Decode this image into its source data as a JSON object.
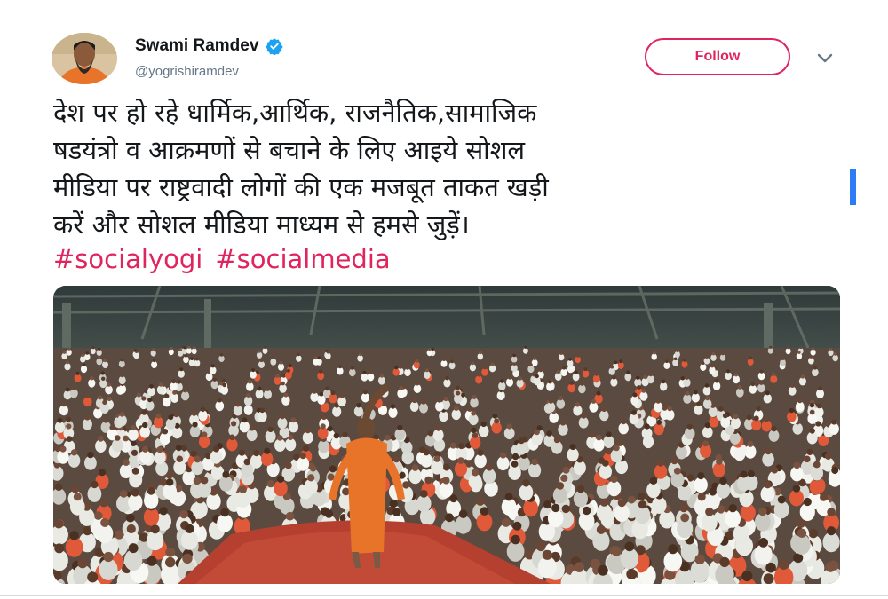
{
  "tweet": {
    "author_name": "Swami Ramdev",
    "handle": "@yogrishiramdev",
    "follow_label": "Follow",
    "text_lines": [
      "देश पर हो रहे धार्मिक,आर्थिक, राजनैतिक,सामाजिक",
      "षडयंत्रो व आक्रमणों से बचाने के लिए आइये सोशल",
      "मीडिया पर राष्ट्रवादी लोगों की एक मजबूत ताकत खड़ी",
      "करें और सोशल मीडिया माध्यम से हमसे जुड़ें।"
    ],
    "hashtags": [
      "#socialyogi",
      "#socialmedia"
    ]
  },
  "colors": {
    "accent": "#e0245e",
    "verified": "#1da1f2",
    "text": "#14171a",
    "muted": "#657786",
    "robe": "#e8742a"
  },
  "icons": {
    "verified": "verified-badge-icon",
    "more": "chevron-down-icon"
  }
}
